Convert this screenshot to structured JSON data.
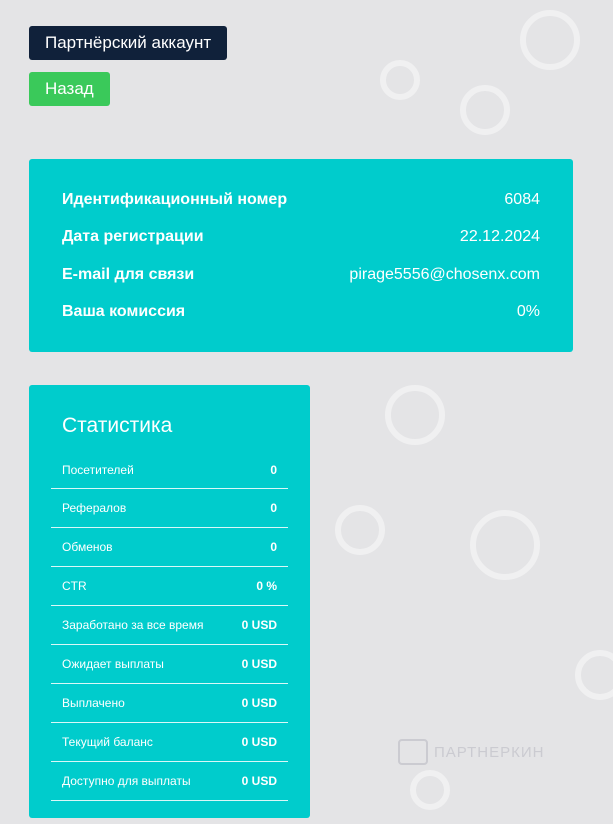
{
  "header": {
    "title": "Партнёрский аккаунт",
    "back_label": "Назад"
  },
  "account": {
    "rows": [
      {
        "label": "Идентификационный номер",
        "value": "6084"
      },
      {
        "label": "Дата регистрации",
        "value": "22.12.2024"
      },
      {
        "label": "E-mail для связи",
        "value": "pirage5556@chosenx.com"
      },
      {
        "label": "Ваша комиссия",
        "value": "0%"
      }
    ]
  },
  "stats": {
    "title": "Статистика",
    "rows": [
      {
        "label": "Посетителей",
        "value": "0"
      },
      {
        "label": "Рефералов",
        "value": "0"
      },
      {
        "label": "Обменов",
        "value": "0"
      },
      {
        "label": "CTR",
        "value": "0 %"
      },
      {
        "label": "Заработано за все время",
        "value": "0 USD"
      },
      {
        "label": "Ожидает выплаты",
        "value": "0 USD"
      },
      {
        "label": "Выплачено",
        "value": "0 USD"
      },
      {
        "label": "Текущий баланс",
        "value": "0 USD"
      },
      {
        "label": "Доступно для выплаты",
        "value": "0 USD"
      }
    ]
  },
  "watermark": {
    "text": "ПАРТНЕРКИН"
  },
  "colors": {
    "background": "#e4e4e6",
    "card": "#00cccc",
    "title_badge": "#10213a",
    "back_button": "#3ac95a"
  },
  "icons": [
    "watermark-logo-icon"
  ]
}
